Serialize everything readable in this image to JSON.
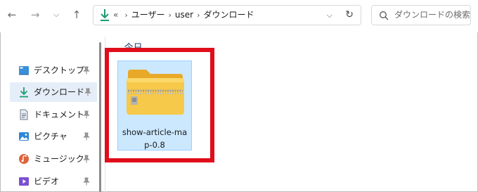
{
  "navigation": {
    "back_icon": "arrow-left-icon",
    "forward_icon": "arrow-right-icon",
    "recent_icon": "chevron-down-icon",
    "up_icon": "arrow-up-icon"
  },
  "address": {
    "icon": "download-arrow-icon",
    "overflow": "«",
    "crumbs": [
      "ユーザー",
      "user",
      "ダウンロード"
    ],
    "dropdown_icon": "chevron-down-icon",
    "refresh_icon": "refresh-icon"
  },
  "search": {
    "placeholder": "ダウンロードの検索"
  },
  "sidebar": {
    "items": [
      {
        "label": "デスクトップ",
        "icon": "desktop-icon",
        "pinned": true
      },
      {
        "label": "ダウンロード",
        "icon": "download-icon",
        "pinned": true,
        "selected": true
      },
      {
        "label": "ドキュメント",
        "icon": "document-icon",
        "pinned": true
      },
      {
        "label": "ピクチャ",
        "icon": "pictures-icon",
        "pinned": true
      },
      {
        "label": "ミュージック",
        "icon": "music-icon",
        "pinned": true
      },
      {
        "label": "ビデオ",
        "icon": "video-icon",
        "pinned": true
      }
    ]
  },
  "content": {
    "group_label": "今日",
    "files": [
      {
        "name": "show-article-map-0.8",
        "name_line1": "show-article-ma",
        "name_line2": "p-0.8",
        "type_icon": "zip-folder-icon",
        "selected": true
      }
    ]
  },
  "colors": {
    "accent": "#0067c0",
    "selection": "#cce8ff",
    "highlight": "#e00d1a",
    "download_green": "#1e9b6e"
  }
}
